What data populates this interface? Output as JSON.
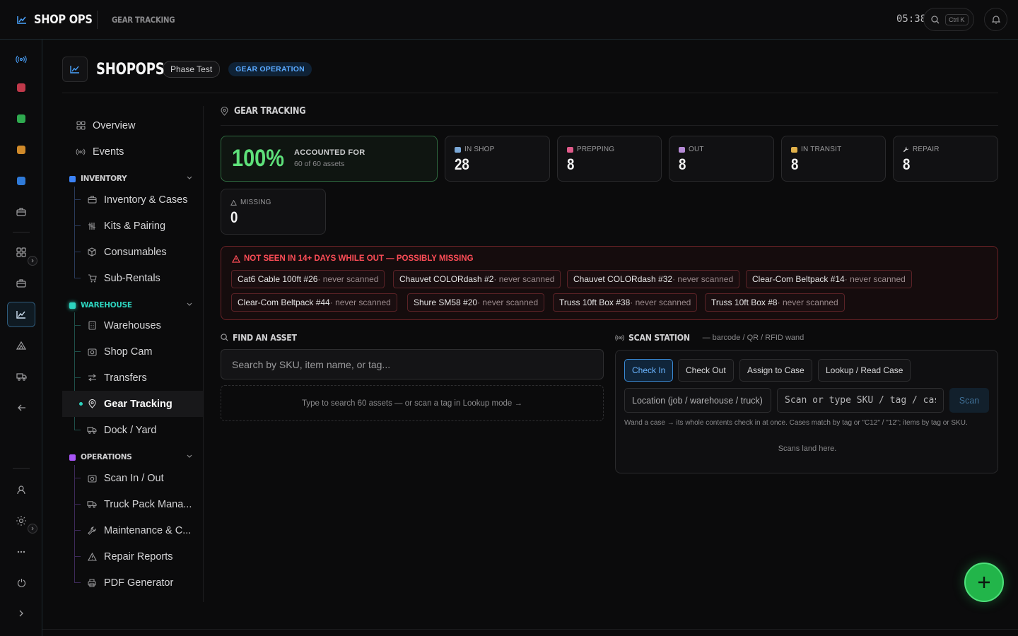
{
  "topbar": {
    "brand": "SHOP OPS",
    "breadcrumb": "GEAR TRACKING",
    "clock": "05:38",
    "search_shortcut": "Ctrl K"
  },
  "header": {
    "title": "SHOPOPS",
    "phase_pill": "Phase Test",
    "mode_pill": "GEAR OPERATION"
  },
  "nav": {
    "overview": "Overview",
    "events": "Events",
    "groups": {
      "inventory": {
        "label": "INVENTORY",
        "color": "#3b82f6",
        "items": [
          "Inventory & Cases",
          "Kits & Pairing",
          "Consumables",
          "Sub-Rentals"
        ]
      },
      "warehouse": {
        "label": "WAREHOUSE",
        "color": "#2dd4bf",
        "items": [
          "Warehouses",
          "Shop Cam",
          "Transfers",
          "Gear Tracking",
          "Dock / Yard"
        ]
      },
      "operations": {
        "label": "OPERATIONS",
        "color": "#a855f7",
        "items": [
          "Scan In / Out",
          "Truck Pack Mana...",
          "Maintenance & C...",
          "Repair Reports",
          "PDF Generator"
        ]
      }
    },
    "active_item": "Gear Tracking"
  },
  "main": {
    "section_title": "GEAR TRACKING",
    "accounted": {
      "percent": "100%",
      "label": "ACCOUNTED FOR",
      "sub": "60 of 60 assets"
    },
    "stats": [
      {
        "label": "IN SHOP",
        "value": "28",
        "color": "#7aa7d6"
      },
      {
        "label": "PREPPING",
        "value": "8",
        "color": "#e05a8a"
      },
      {
        "label": "OUT",
        "value": "8",
        "color": "#b58ad6"
      },
      {
        "label": "IN TRANSIT",
        "value": "8",
        "color": "#e0b04a"
      },
      {
        "label": "REPAIR",
        "value": "8",
        "color": "#cfcfd1"
      },
      {
        "label": "MISSING",
        "value": "0",
        "color": "#9a9a9c"
      }
    ],
    "alert": {
      "title": "NOT SEEN IN 14+ DAYS WHILE OUT — POSSIBLY MISSING",
      "chips": [
        {
          "name": "Cat6 Cable 100ft #26",
          "status": " · never scanned"
        },
        {
          "name": "Chauvet COLORdash #2",
          "status": " · never scanned"
        },
        {
          "name": "Chauvet COLORdash #32",
          "status": " · never scanned"
        },
        {
          "name": "Clear-Com Beltpack #14",
          "status": " · never scanned"
        },
        {
          "name": "Clear-Com Beltpack #44",
          "status": " · never scanned"
        },
        {
          "name": "Shure SM58 #20",
          "status": " · never scanned"
        },
        {
          "name": "Truss 10ft Box #38",
          "status": " · never scanned"
        },
        {
          "name": "Truss 10ft Box #8",
          "status": " · never scanned"
        }
      ]
    },
    "find": {
      "title": "FIND AN ASSET",
      "placeholder": "Search by SKU, item name, or tag...",
      "hint": "Type to search 60 assets — or scan a tag in Lookup mode →"
    },
    "scan": {
      "title": "SCAN STATION",
      "subtitle": "— barcode / QR / RFID wand",
      "modes": [
        "Check In",
        "Check Out",
        "Assign to Case",
        "Lookup / Read Case"
      ],
      "active_mode": "Check In",
      "location_placeholder": "Location (job / warehouse / truck)",
      "sku_placeholder": "Scan or type SKU / tag / case",
      "scan_button": "Scan",
      "help": "Wand a case → its whole contents check in at once. Cases match by tag or \"C12\" / \"12\"; items by tag or SKU.",
      "empty": "Scans land here."
    }
  }
}
